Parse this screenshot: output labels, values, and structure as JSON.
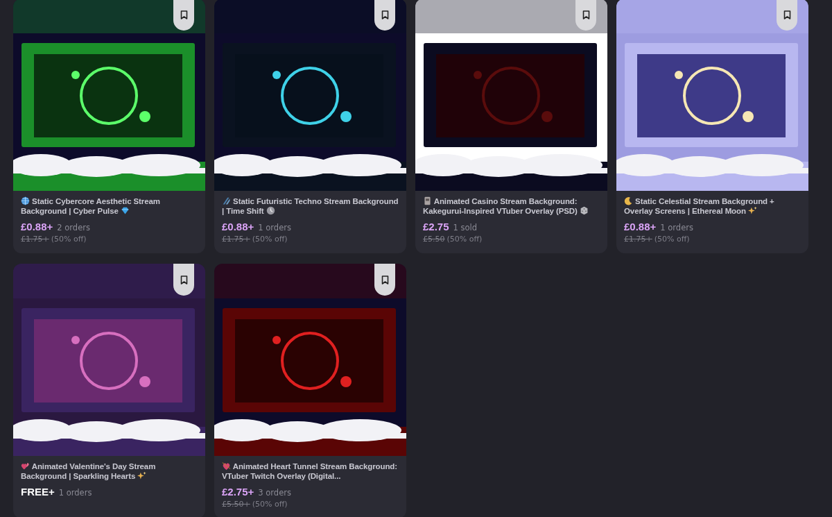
{
  "products": [
    {
      "title": "Static Cybercore Aesthetic Stream Background | Cyber Pulse",
      "price": "£0.88+",
      "free": false,
      "sales": "2 orders",
      "old_price": "£1.75+",
      "discount": "(50% off)"
    },
    {
      "title": "Static Futuristic Techno Stream Background | Time Shift",
      "price": "£0.88+",
      "free": false,
      "sales": "1 orders",
      "old_price": "£1.75+",
      "discount": "(50% off)"
    },
    {
      "title": "Animated Casino Stream Background: Kakegurui-Inspired VTuber Overlay (PSD)",
      "price": "£2.75",
      "free": false,
      "sales": "1 sold",
      "old_price": "£5.50",
      "discount": "(50% off)"
    },
    {
      "title": "Static Celestial Stream Background + Overlay Screens | Ethereal Moon",
      "price": "£0.88+",
      "free": false,
      "sales": "1 orders",
      "old_price": "£1.75+",
      "discount": "(50% off)"
    },
    {
      "title": "Animated Valentine's Day Stream Background | Sparkling Hearts",
      "price": "FREE+",
      "free": true,
      "sales": "1 orders"
    },
    {
      "title": "Animated Heart Tunnel Stream Background: VTuber Twitch Overlay (Digital...",
      "price": "£2.75+",
      "free": false,
      "sales": "3 orders",
      "old_price": "£5.50+",
      "discount": "(50% off)"
    }
  ]
}
